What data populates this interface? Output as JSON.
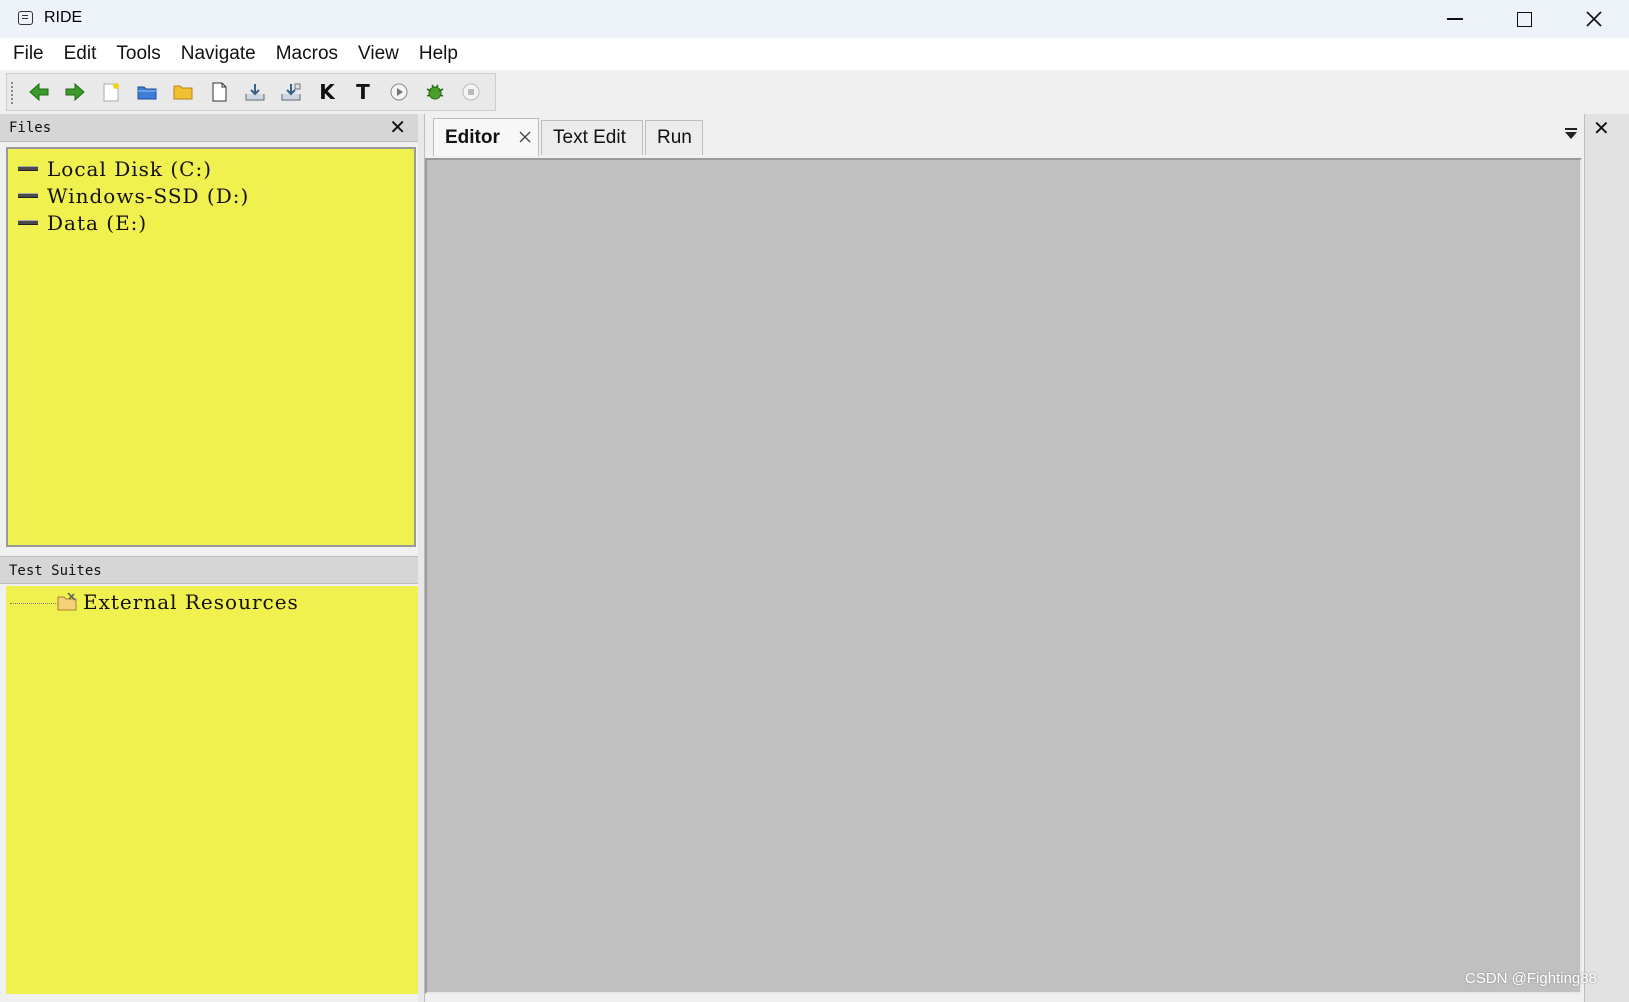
{
  "window": {
    "title": "RIDE"
  },
  "menu": [
    "File",
    "Edit",
    "Tools",
    "Navigate",
    "Macros",
    "View",
    "Help"
  ],
  "toolbar": {
    "keyword_label": "K",
    "test_label": "T"
  },
  "files_panel": {
    "title": "Files",
    "close_label": "✕",
    "drives": [
      "Local Disk (C:)",
      "Windows-SSD (D:)",
      "Data (E:)"
    ]
  },
  "suites_panel": {
    "title": "Test Suites",
    "items": [
      "External Resources"
    ]
  },
  "notebook": {
    "tabs": [
      "Editor",
      "Text Edit",
      "Run"
    ]
  },
  "right_panel": {
    "close_label": "✕"
  },
  "watermark": "CSDN @Fighting88",
  "colors": {
    "tree_bg": "#f0f04e",
    "editor_bg": "#c0c0c0"
  }
}
